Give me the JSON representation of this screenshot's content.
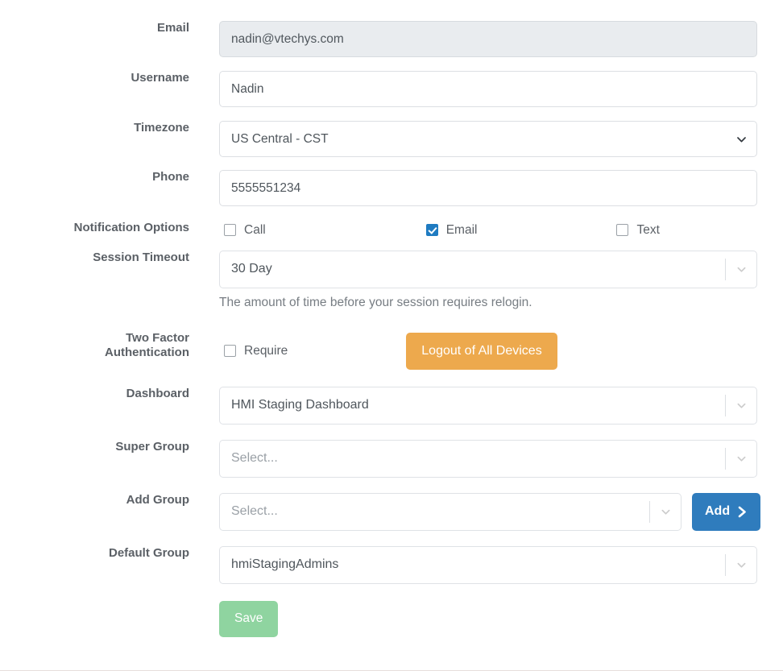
{
  "form": {
    "fields": {
      "email": {
        "label": "Email",
        "value": "nadin@vtechys.com",
        "disabled": true
      },
      "username": {
        "label": "Username",
        "value": "Nadin"
      },
      "timezone": {
        "label": "Timezone",
        "value": "US Central - CST",
        "options": [
          "US Central - CST"
        ]
      },
      "phone": {
        "label": "Phone",
        "value": "5555551234"
      },
      "notification_options": {
        "label": "Notification Options",
        "items": [
          {
            "label": "Call",
            "checked": false
          },
          {
            "label": "Email",
            "checked": true
          },
          {
            "label": "Text",
            "checked": false
          }
        ]
      },
      "session_timeout": {
        "label": "Session Timeout",
        "value": "30 Day",
        "help": "The amount of time before your session requires relogin."
      },
      "two_factor": {
        "label": "Two Factor Authentication",
        "require_label": "Require",
        "require_checked": false,
        "logout_button": "Logout of All Devices"
      },
      "dashboard": {
        "label": "Dashboard",
        "value": "HMI Staging Dashboard"
      },
      "super_group": {
        "label": "Super Group",
        "value": "Select..."
      },
      "add_group": {
        "label": "Add Group",
        "value": "Select...",
        "add_button": "Add"
      },
      "default_group": {
        "label": "Default Group",
        "value": "hmiStagingAdmins"
      }
    },
    "save_button": "Save"
  },
  "colors": {
    "primary": "#2f7cbd",
    "warning": "#eda94d",
    "success": "#8fd4a0",
    "checkbox_checked": "#1f7bc1",
    "label_text": "#5b6066",
    "border": "#dcdfe3",
    "disabled_bg": "#e9ecef"
  },
  "icons": {
    "chevron_down": "chevron-down-icon",
    "chevron_right": "chevron-right-icon",
    "checkmark": "checkmark-icon"
  }
}
